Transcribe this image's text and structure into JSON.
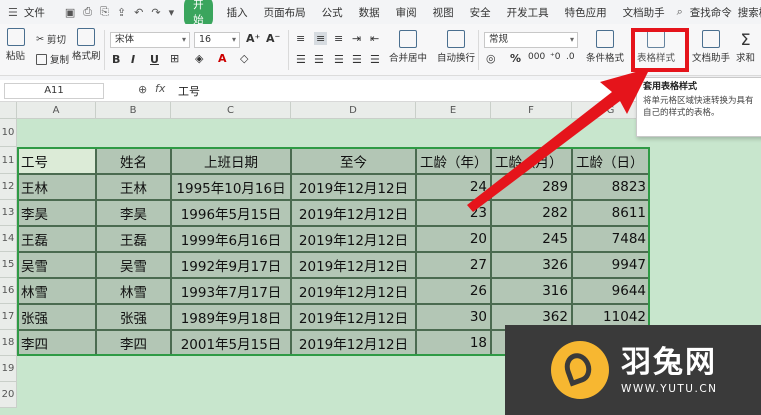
{
  "menubar": {
    "file_label": "文件",
    "start_label": "开始",
    "tabs": [
      "插入",
      "页面布局",
      "公式",
      "数据",
      "审阅",
      "视图",
      "安全",
      "开发工具",
      "特色应用",
      "文档助手"
    ],
    "search_label": "查找命令",
    "template_label": "搜索模板"
  },
  "ribbon": {
    "paste": "粘贴",
    "cut": "剪切",
    "copy": "复制",
    "format_painter": "格式刷",
    "font_name": "宋体",
    "font_size": "16",
    "merge_center": "合并居中",
    "auto_wrap": "自动换行",
    "number_format": "常规",
    "cond_format": "条件格式",
    "table_style": "表格样式",
    "doc_helper": "文档助手",
    "sum": "求和"
  },
  "formula_bar": {
    "cell_ref": "A11",
    "value": "工号"
  },
  "tooltip": {
    "title": "套用表格样式",
    "body": "将单元格区域快速转换为具有自己的样式的表格。"
  },
  "sheet": {
    "columns": [
      "A",
      "B",
      "C",
      "D",
      "E",
      "F",
      "G"
    ],
    "rows": [
      "10",
      "11",
      "12",
      "13",
      "14",
      "15",
      "16",
      "17",
      "18",
      "19",
      "20"
    ],
    "table": {
      "headers": [
        "工号",
        "姓名",
        "上班日期",
        "至今",
        "工龄（年）",
        "工龄（月）",
        "工龄（日）"
      ],
      "data": [
        [
          "王林",
          "王林",
          "1995年10月16日",
          "2019年12月12日",
          "24",
          "289",
          "8823"
        ],
        [
          "李昊",
          "李昊",
          "1996年5月15日",
          "2019年12月12日",
          "23",
          "282",
          "8611"
        ],
        [
          "王磊",
          "王磊",
          "1999年6月16日",
          "2019年12月12日",
          "20",
          "245",
          "7484"
        ],
        [
          "吴雪",
          "吴雪",
          "1992年9月17日",
          "2019年12月12日",
          "27",
          "326",
          "9947"
        ],
        [
          "林雪",
          "林雪",
          "1993年7月17日",
          "2019年12月12日",
          "26",
          "316",
          "9644"
        ],
        [
          "张强",
          "张强",
          "1989年9月18日",
          "2019年12月12日",
          "30",
          "362",
          "11042"
        ],
        [
          "李四",
          "李四",
          "2001年5月15日",
          "2019年12月12日",
          "18",
          "",
          ""
        ]
      ]
    }
  },
  "logo": {
    "name": "羽兔网",
    "url": "WWW.YUTU.CN"
  },
  "colors": {
    "highlight": "#e5141b",
    "table_border": "#2f9a45",
    "sheet_bg": "#c8e6cd"
  }
}
